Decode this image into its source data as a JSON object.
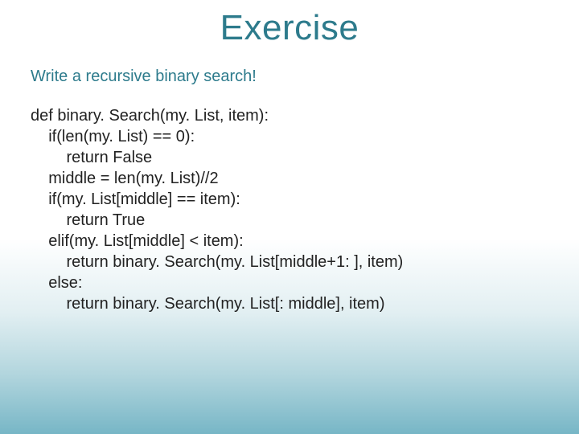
{
  "title": "Exercise",
  "subtitle": "Write a recursive binary search!",
  "code": "def binary. Search(my. List, item):\n    if(len(my. List) == 0):\n        return False\n    middle = len(my. List)//2\n    if(my. List[middle] == item):\n        return True\n    elif(my. List[middle] < item):\n        return binary. Search(my. List[middle+1: ], item)\n    else:\n        return binary. Search(my. List[: middle], item)"
}
